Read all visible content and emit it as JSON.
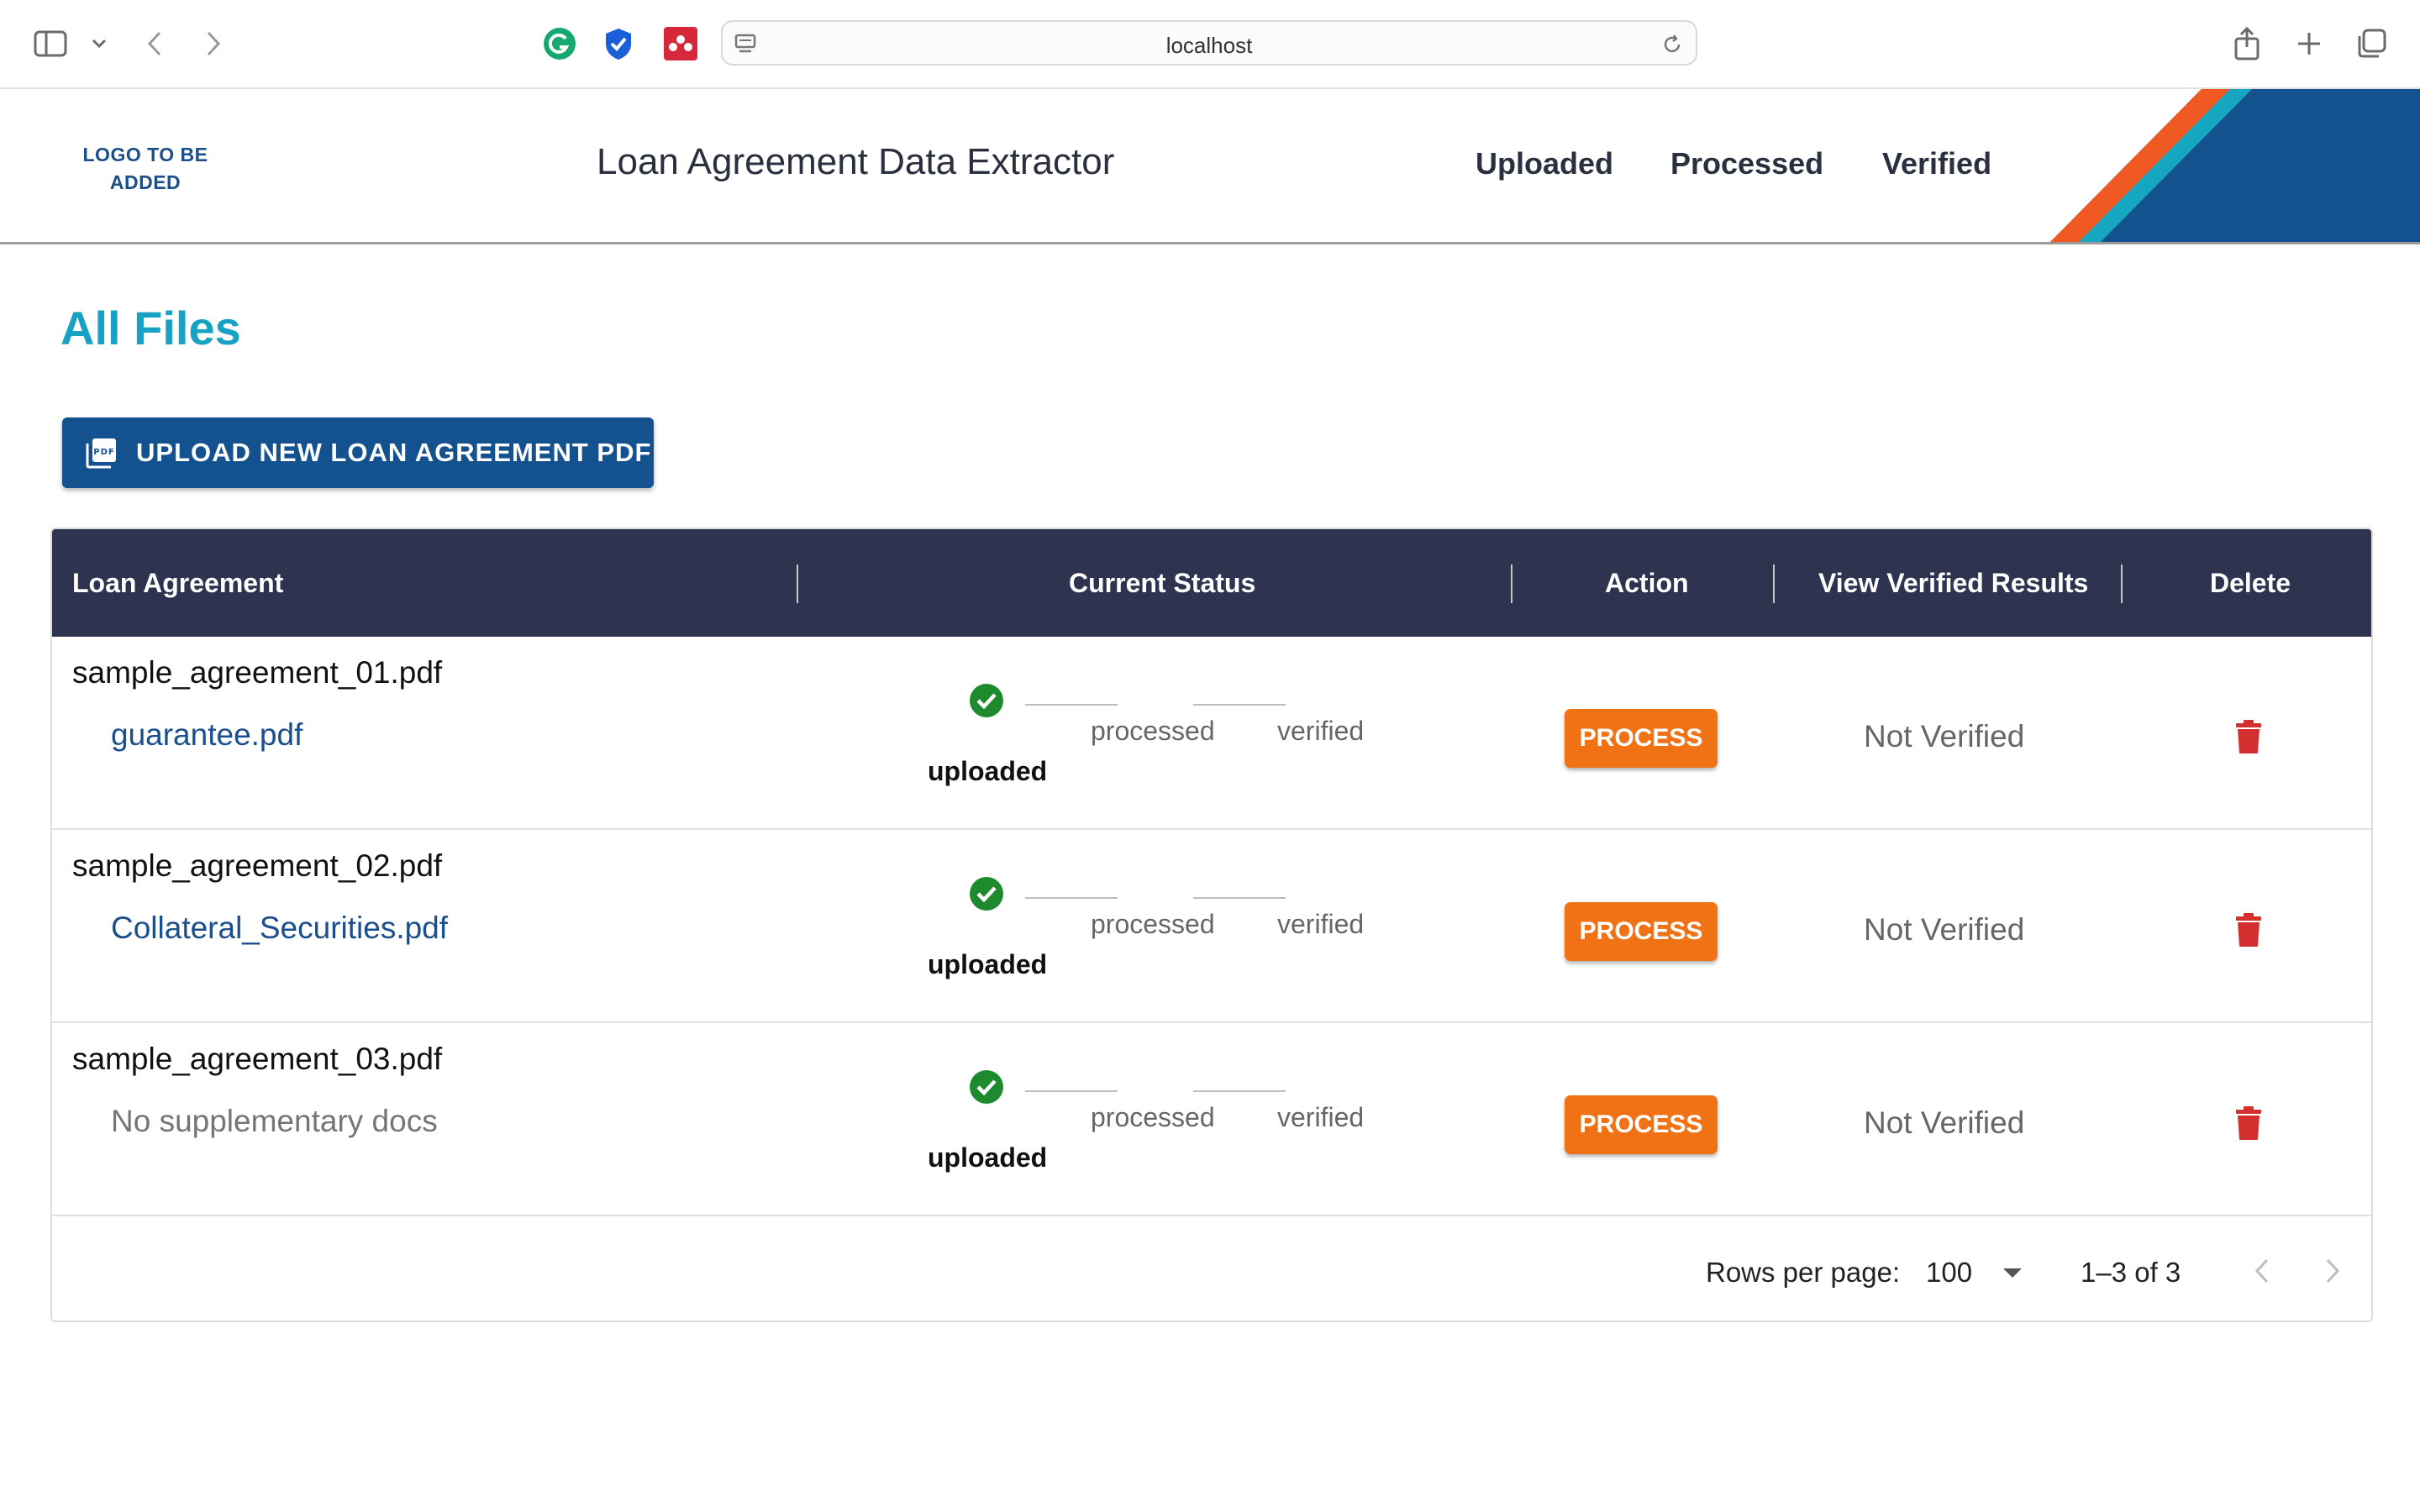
{
  "browser": {
    "url": "localhost"
  },
  "header": {
    "logo_text": "LOGO TO BE ADDED",
    "title": "Loan Agreement Data Extractor",
    "nav": [
      "Uploaded",
      "Processed",
      "Verified"
    ]
  },
  "page": {
    "title": "All Files",
    "upload_button": "UPLOAD NEW LOAN AGREEMENT PDF"
  },
  "table": {
    "columns": [
      "Loan Agreement",
      "Current Status",
      "Action",
      "View Verified Results",
      "Delete"
    ],
    "rows": [
      {
        "file": "sample_agreement_01.pdf",
        "supplementary": "guarantee.pdf",
        "supplementary_is_link": true,
        "steps": [
          "uploaded",
          "processed",
          "verified"
        ],
        "action": "PROCESS",
        "verified": "Not Verified"
      },
      {
        "file": "sample_agreement_02.pdf",
        "supplementary": "Collateral_Securities.pdf",
        "supplementary_is_link": true,
        "steps": [
          "uploaded",
          "processed",
          "verified"
        ],
        "action": "PROCESS",
        "verified": "Not Verified"
      },
      {
        "file": "sample_agreement_03.pdf",
        "supplementary": "No supplementary docs",
        "supplementary_is_link": false,
        "steps": [
          "uploaded",
          "processed",
          "verified"
        ],
        "action": "PROCESS",
        "verified": "Not Verified"
      }
    ],
    "footer": {
      "rows_per_page_label": "Rows per page:",
      "rows_per_page_value": "100",
      "range": "1–3 of 3"
    }
  },
  "colors": {
    "brand_blue": "#14518f",
    "accent_cyan": "#17a2c4",
    "accent_orange": "#f07214",
    "header_dark": "#2e3450",
    "success_green": "#1e8a2e",
    "danger_red": "#d32f2f"
  }
}
